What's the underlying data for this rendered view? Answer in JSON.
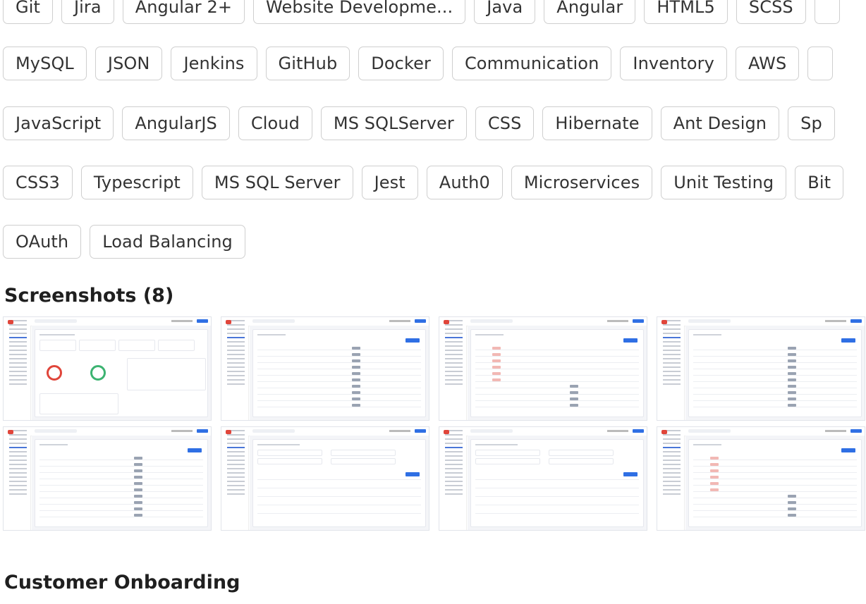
{
  "skill_rows": [
    [
      "Git",
      "Jira",
      "Angular 2+",
      "Website Developme...",
      "Java",
      "Angular",
      "HTML5",
      "SCSS",
      ""
    ],
    [
      "MySQL",
      "JSON",
      "Jenkins",
      "GitHub",
      "Docker",
      "Communication",
      "Inventory",
      "AWS",
      ""
    ],
    [
      "JavaScript",
      "AngularJS",
      "Cloud",
      "MS SQLServer",
      "CSS",
      "Hibernate",
      "Ant Design",
      "Sp"
    ],
    [
      "CSS3",
      "Typescript",
      "MS SQL Server",
      "Jest",
      "Auth0",
      "Microservices",
      "Unit Testing",
      "Bit"
    ],
    [
      "OAuth",
      "Load Balancing"
    ]
  ],
  "screenshots_heading": "Screenshots (8)",
  "screenshots": [
    {
      "variant": "dashboard"
    },
    {
      "variant": "table"
    },
    {
      "variant": "detail"
    },
    {
      "variant": "table"
    },
    {
      "variant": "table"
    },
    {
      "variant": "form"
    },
    {
      "variant": "form"
    },
    {
      "variant": "detail"
    }
  ],
  "next_section_heading": "Customer Onboarding",
  "colors": {
    "accent": "#2f6fe4",
    "danger": "#e0453a",
    "success": "#3cb371",
    "border": "#cfcfcf"
  }
}
